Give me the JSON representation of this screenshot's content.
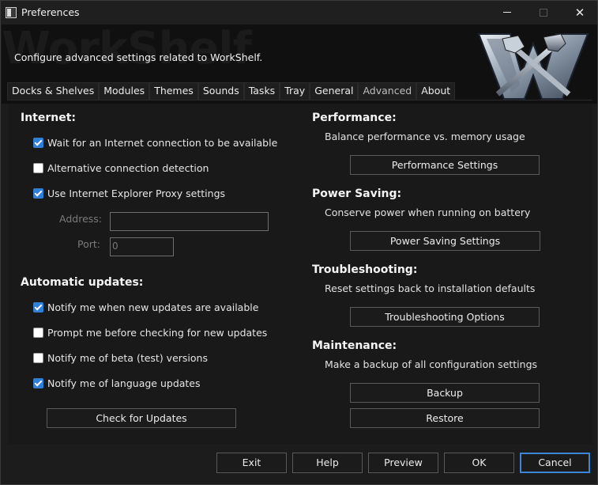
{
  "window": {
    "title": "Preferences"
  },
  "banner": {
    "watermark": "WorkShelf",
    "description": "Configure advanced settings related to WorkShelf."
  },
  "tabs": [
    {
      "label": "Docks & Shelves",
      "active": false
    },
    {
      "label": "Modules",
      "active": false
    },
    {
      "label": "Themes",
      "active": false
    },
    {
      "label": "Sounds",
      "active": false
    },
    {
      "label": "Tasks",
      "active": false
    },
    {
      "label": "Tray",
      "active": false
    },
    {
      "label": "General",
      "active": false
    },
    {
      "label": "Advanced",
      "active": true
    },
    {
      "label": "About",
      "active": false
    }
  ],
  "internet": {
    "heading": "Internet:",
    "options": [
      {
        "label": "Wait for an Internet connection to be available",
        "checked": true
      },
      {
        "label": "Alternative connection detection",
        "checked": false
      },
      {
        "label": "Use Internet Explorer Proxy settings",
        "checked": true
      }
    ],
    "address_label": "Address:",
    "address_value": "",
    "port_label": "Port:",
    "port_value": "0"
  },
  "updates": {
    "heading": "Automatic updates:",
    "options": [
      {
        "label": "Notify me when new updates are available",
        "checked": true
      },
      {
        "label": "Prompt me before checking for new updates",
        "checked": false
      },
      {
        "label": "Notify me of beta (test) versions",
        "checked": false
      },
      {
        "label": "Notify me of language updates",
        "checked": true
      }
    ],
    "check_button": "Check for Updates"
  },
  "performance": {
    "heading": "Performance:",
    "description": "Balance performance vs. memory usage",
    "button": "Performance Settings"
  },
  "power": {
    "heading": "Power Saving:",
    "description": "Conserve power when running on battery",
    "button": "Power Saving Settings"
  },
  "troubleshooting": {
    "heading": "Troubleshooting:",
    "description": "Reset settings back to installation defaults",
    "button": "Troubleshooting Options"
  },
  "maintenance": {
    "heading": "Maintenance:",
    "description": "Make a backup of all configuration settings",
    "backup_button": "Backup",
    "restore_button": "Restore"
  },
  "footer": {
    "exit": "Exit",
    "help": "Help",
    "preview": "Preview",
    "ok": "OK",
    "cancel": "Cancel"
  },
  "icons": {
    "app": "app-window-icon",
    "minimize": "minimize-icon",
    "maximize": "maximize-icon",
    "close": "close-icon",
    "logo": "workshelf-hammer-logo"
  },
  "colors": {
    "accent": "#2f7fd6",
    "background": "#191919",
    "banner": "#101010"
  }
}
